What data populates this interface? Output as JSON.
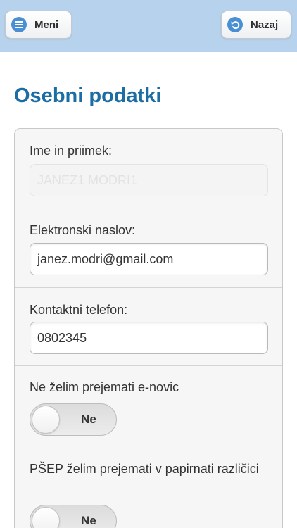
{
  "header": {
    "menu_label": "Meni",
    "menu_icon": "menu-icon",
    "back_label": "Nazaj",
    "back_icon": "back-arrow-icon",
    "background_color": "#b7d2ec"
  },
  "page_title": "Osebni podatki",
  "form": {
    "name": {
      "label": "Ime in priimek:",
      "value": "JANEZ1 MODRI1",
      "disabled": true
    },
    "email": {
      "label": "Elektronski naslov:",
      "value": "janez.modri@gmail.com"
    },
    "phone": {
      "label": "Kontaktni telefon:",
      "value": "0802345"
    },
    "newsletter": {
      "label": "Ne želim prejemati e-novic",
      "toggle_label": "Ne",
      "checked": false
    },
    "paper": {
      "label": "PŠEP želim prejemati v papirnati različici",
      "toggle_label": "Ne",
      "checked": false
    }
  },
  "colors": {
    "title": "#1b6da3",
    "icon_blue": "#4a8fd4"
  }
}
